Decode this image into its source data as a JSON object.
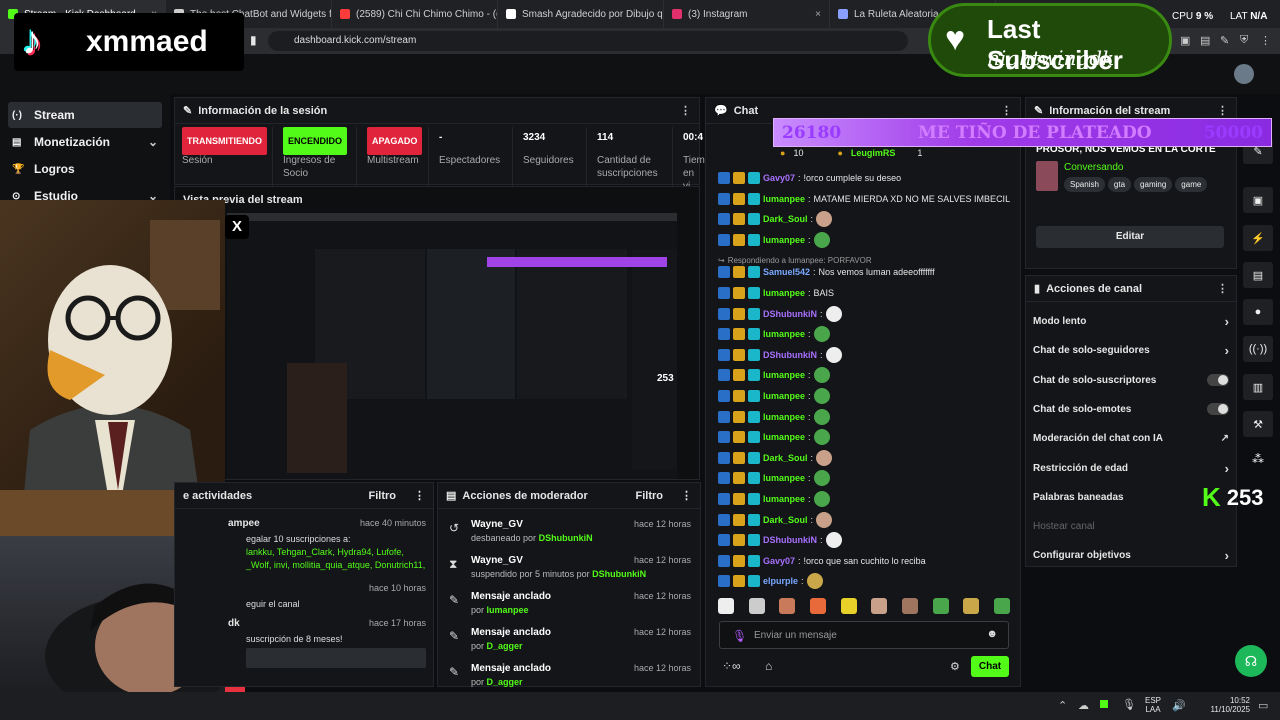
{
  "browser": {
    "tabs": [
      {
        "label": "Stream - Kick Dashboard",
        "color": "#53fc18",
        "active": true
      },
      {
        "label": "The best ChatBot and Widgets for Ki",
        "color": "#cccccc"
      },
      {
        "label": "(2589) Chi Chi Chimo Chimo - (( Mitc",
        "color": "#ff3b3b"
      },
      {
        "label": "Smash Agradecido por Dibujo que le",
        "color": "#ffffff"
      },
      {
        "label": "(3) Instagram",
        "color": "#e1306c"
      },
      {
        "label": "La Ruleta Aleatoria",
        "color": "#8aa0ff"
      }
    ],
    "url": "dashboard.kick.com/stream",
    "cpu_label": "CPU",
    "cpu_value": "9 %",
    "lat_label": "LAT",
    "lat_value": "N/A"
  },
  "overlay": {
    "tiktok_name": "xmmaed",
    "last_sub_title": "Last Subscriber",
    "last_sub_name": "nightwingdk",
    "x_icon": "X",
    "alert_left": "26180",
    "alert_text": "ME TIÑO DE PLATEADO",
    "alert_right": "50000",
    "kick_count": "253"
  },
  "sidebar": {
    "items": [
      {
        "label": "Stream",
        "icon": "(·)",
        "active": true
      },
      {
        "label": "Monetización",
        "icon": "▤",
        "chevron": true
      },
      {
        "label": "Logros",
        "icon": "🏆"
      },
      {
        "label": "Estudio",
        "icon": "⊙",
        "chevron": true
      }
    ]
  },
  "session": {
    "title": "Información de la sesión",
    "stats": [
      {
        "value": "TRANSMITIENDO",
        "label": "Sesión",
        "badge": "#e0243b"
      },
      {
        "value": "ENCENDIDO",
        "label": "Ingresos de Socio",
        "badge": "#53fc18"
      },
      {
        "value": "APAGADO",
        "label": "Multistream",
        "badge": "#e0243b"
      },
      {
        "value": "-",
        "label": "Espectadores"
      },
      {
        "value": "3234",
        "label": "Seguidores"
      },
      {
        "value": "114",
        "label": "Cantidad de suscripciones"
      },
      {
        "value": "00:4",
        "label": "Tiem en vi"
      }
    ]
  },
  "preview": {
    "title": "Vista previa del stream"
  },
  "activities": {
    "title": "e actividades",
    "filter": "Filtro",
    "items": [
      {
        "user": "ampee",
        "time": "hace 40 minutos",
        "line1": "egalar 10 suscripciones a:",
        "line2": "lankku, Tehgan_Clark, Hydra94, Lufofe,",
        "line3": "_Wolf, invi, mollitia_quia_atque, Donutrich11,"
      },
      {
        "user": "",
        "time": "hace 10 horas",
        "line1": "eguir el canal"
      },
      {
        "user": "dk",
        "time": "hace 17 horas",
        "line1": "suscripción de 8 meses!"
      }
    ]
  },
  "modactions": {
    "title": "Acciones de moderador",
    "filter": "Filtro",
    "items": [
      {
        "icon": "↺",
        "title": "Wayne_GV",
        "sub": "desbaneado por",
        "who": "DShubunkiN",
        "time": "hace 12 horas"
      },
      {
        "icon": "⧗",
        "title": "Wayne_GV",
        "sub": "suspendido por 5 minutos por",
        "who": "DShubunkiN",
        "time": "hace 12 horas"
      },
      {
        "icon": "✎",
        "title": "Mensaje anclado",
        "sub": "por",
        "who": "lumanpee",
        "time": "hace 12 horas"
      },
      {
        "icon": "✎",
        "title": "Mensaje anclado",
        "sub": "por",
        "who": "D_agger",
        "time": "hace 12 horas"
      },
      {
        "icon": "✎",
        "title": "Mensaje anclado",
        "sub": "por",
        "who": "D_agger",
        "time": "hace 12 horas"
      }
    ]
  },
  "chat": {
    "title": "Chat",
    "top": {
      "count": "10",
      "user": "LeugimRS",
      "gifts": "1"
    },
    "messages": [
      {
        "user": "Gavy07",
        "color": "p",
        "text": "!orco cumplele su deseo"
      },
      {
        "user": "lumanpee",
        "color": "g",
        "text": "MATAME MIERDA XD NO ME SALVES IMBECIL"
      },
      {
        "user": "Dark_Soul",
        "color": "g",
        "text": "",
        "emote": "#c9a08a"
      },
      {
        "user": "lumanpee",
        "color": "g",
        "text": "",
        "emote": "#4aa64a"
      },
      {
        "reply": "Respondiendo a lumanpee: PORFAVOR",
        "user": "Samuel542",
        "color": "b",
        "text": "Nos vemos luman adeeofffffff"
      },
      {
        "user": "lumanpee",
        "color": "g",
        "text": "BAIS"
      },
      {
        "user": "DShubunkiN",
        "color": "p",
        "text": "",
        "emote": "#eeeeee"
      },
      {
        "user": "lumanpee",
        "color": "g",
        "text": "",
        "emote": "#4aa64a"
      },
      {
        "user": "DShubunkiN",
        "color": "p",
        "text": "",
        "emote": "#eeeeee"
      },
      {
        "user": "lumanpee",
        "color": "g",
        "text": "",
        "emote": "#4aa64a"
      },
      {
        "user": "lumanpee",
        "color": "g",
        "text": "",
        "emote": "#4aa64a"
      },
      {
        "user": "lumanpee",
        "color": "g",
        "text": "",
        "emote": "#4aa64a"
      },
      {
        "user": "lumanpee",
        "color": "g",
        "text": "",
        "emote": "#4aa64a"
      },
      {
        "user": "Dark_Soul",
        "color": "g",
        "text": "",
        "emote": "#c9a08a"
      },
      {
        "user": "lumanpee",
        "color": "g",
        "text": "",
        "emote": "#4aa64a"
      },
      {
        "user": "lumanpee",
        "color": "g",
        "text": "",
        "emote": "#4aa64a"
      },
      {
        "user": "Dark_Soul",
        "color": "g",
        "text": "",
        "emote": "#c9a08a"
      },
      {
        "user": "DShubunkiN",
        "color": "p",
        "text": "",
        "emote": "#eeeeee"
      },
      {
        "user": "Gavy07",
        "color": "p",
        "text": "!orco que san cuchito lo reciba"
      },
      {
        "user": "elpurple",
        "color": "b",
        "text": "",
        "emote": "#caa84a"
      }
    ],
    "input_placeholder": "Enviar un mensaje",
    "send_label": "Chat"
  },
  "streaminfo": {
    "title": "Información del stream",
    "desc": "PATOABOGADO DEFIENDO A MI PROSOR, NOS VEMOS EN LA CORTE YO EL QUE L...",
    "category": "Conversando",
    "tags": [
      "Spanish",
      "gta",
      "gaming",
      "game"
    ],
    "edit_label": "Editar"
  },
  "channel": {
    "title": "Acciones de canal",
    "items": [
      {
        "label": "Modo lento",
        "kind": "chev"
      },
      {
        "label": "Chat de solo-seguidores",
        "kind": "chev"
      },
      {
        "label": "Chat de solo-suscriptores",
        "kind": "tog"
      },
      {
        "label": "Chat de solo-emotes",
        "kind": "tog"
      },
      {
        "label": "Moderación del chat con IA",
        "kind": "ext"
      },
      {
        "label": "Restricción de edad",
        "kind": "chev"
      },
      {
        "label": "Palabras baneadas",
        "kind": "none"
      },
      {
        "label": "Hostear canal",
        "kind": "dim"
      },
      {
        "label": "Configurar objetivos",
        "kind": "chev"
      }
    ]
  },
  "taskbar": {
    "lang1": "ESP",
    "lang2": "LAA",
    "time": "10:52",
    "date": "11/10/2025"
  }
}
